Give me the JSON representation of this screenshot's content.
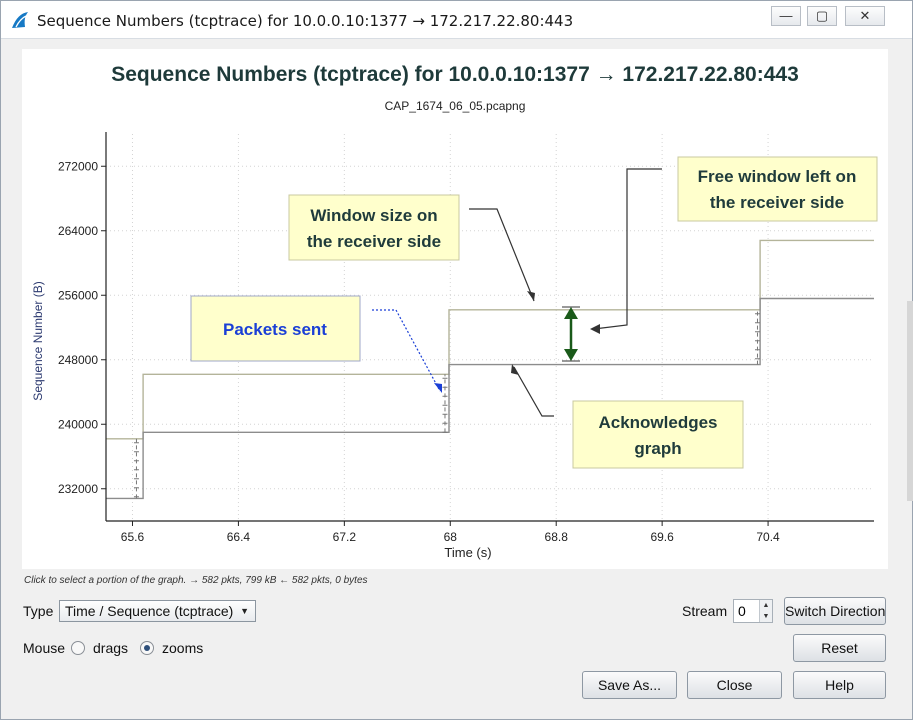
{
  "window": {
    "title": "Sequence Numbers (tcptrace) for 10.0.0.10:1377 → 172.217.22.80:443",
    "controls": {
      "minimize": "—",
      "maximize": "▢",
      "close": "✕"
    }
  },
  "chart_data": {
    "type": "line",
    "title": "Sequence Numbers (tcptrace) for 10.0.0.10:1377 → 172.217.22.80:443",
    "subtitle": "CAP_1674_06_05.pcapng",
    "xlabel": "Time (s)",
    "ylabel": "Sequence Number (B)",
    "xlim": [
      65.4,
      71.2
    ],
    "ylim": [
      228000,
      276000
    ],
    "x_ticks": [
      "65.6",
      "66.4",
      "67.2",
      "68",
      "68.8",
      "69.6",
      "70.4"
    ],
    "x_tick_values": [
      65.6,
      66.4,
      67.2,
      68.0,
      68.8,
      69.6,
      70.4
    ],
    "y_ticks": [
      "232000",
      "240000",
      "248000",
      "256000",
      "264000",
      "272000"
    ],
    "y_tick_values": [
      232000,
      240000,
      248000,
      256000,
      264000,
      272000
    ],
    "grid": true,
    "series": [
      {
        "name": "Window size on the receiver side",
        "x": [
          65.4,
          65.68,
          65.68,
          67.99,
          67.99,
          70.34,
          70.34,
          71.2
        ],
        "y": [
          238200,
          238200,
          246200,
          246200,
          254200,
          254200,
          262800,
          262800
        ]
      },
      {
        "name": "Acknowledges graph",
        "x": [
          65.4,
          65.68,
          65.68,
          67.99,
          67.99,
          70.34,
          70.34,
          71.2
        ],
        "y": [
          230800,
          230800,
          239000,
          239000,
          247400,
          247400,
          255600,
          255600
        ]
      },
      {
        "name": "Packets sent",
        "segments": [
          {
            "x": 65.63,
            "y0": 230800,
            "y1": 238200
          },
          {
            "x": 67.96,
            "y0": 239000,
            "y1": 246200
          },
          {
            "x": 70.32,
            "y0": 247400,
            "y1": 254200
          }
        ]
      }
    ],
    "annotations": [
      {
        "label": "Window size on the receiver side",
        "lines": [
          "Window  size on",
          "the receiver side"
        ]
      },
      {
        "label": "Free window left on the receiver side",
        "lines": [
          "Free window  left on",
          "the receiver side"
        ]
      },
      {
        "label": "Packets sent",
        "lines": [
          "Packets sent"
        ]
      },
      {
        "label": "Acknowledges graph",
        "lines": [
          "Acknowledges",
          "graph"
        ]
      }
    ],
    "colors": {
      "window_line": "#b4b49a",
      "ack_line": "#8c8c8c",
      "packet_marks": "#777777",
      "callout_bg": "#ffffcc",
      "packets_text": "#1a3fd6",
      "title_text": "#1e3a3a",
      "gap_arrow": "#1a5a1a"
    }
  },
  "hint": "Click to select a portion of the graph. → 582 pkts, 799 kB ← 582 pkts, 0 bytes",
  "controls": {
    "type_label": "Type",
    "type_value": "Time / Sequence (tcptrace)",
    "stream_label": "Stream",
    "stream_value": "0",
    "switch_direction": "Switch Direction",
    "mouse_label": "Mouse",
    "mouse_drags": "drags",
    "mouse_zooms": "zooms",
    "mouse_selected": "zooms",
    "reset": "Reset",
    "save_as": "Save As...",
    "close": "Close",
    "help": "Help"
  }
}
